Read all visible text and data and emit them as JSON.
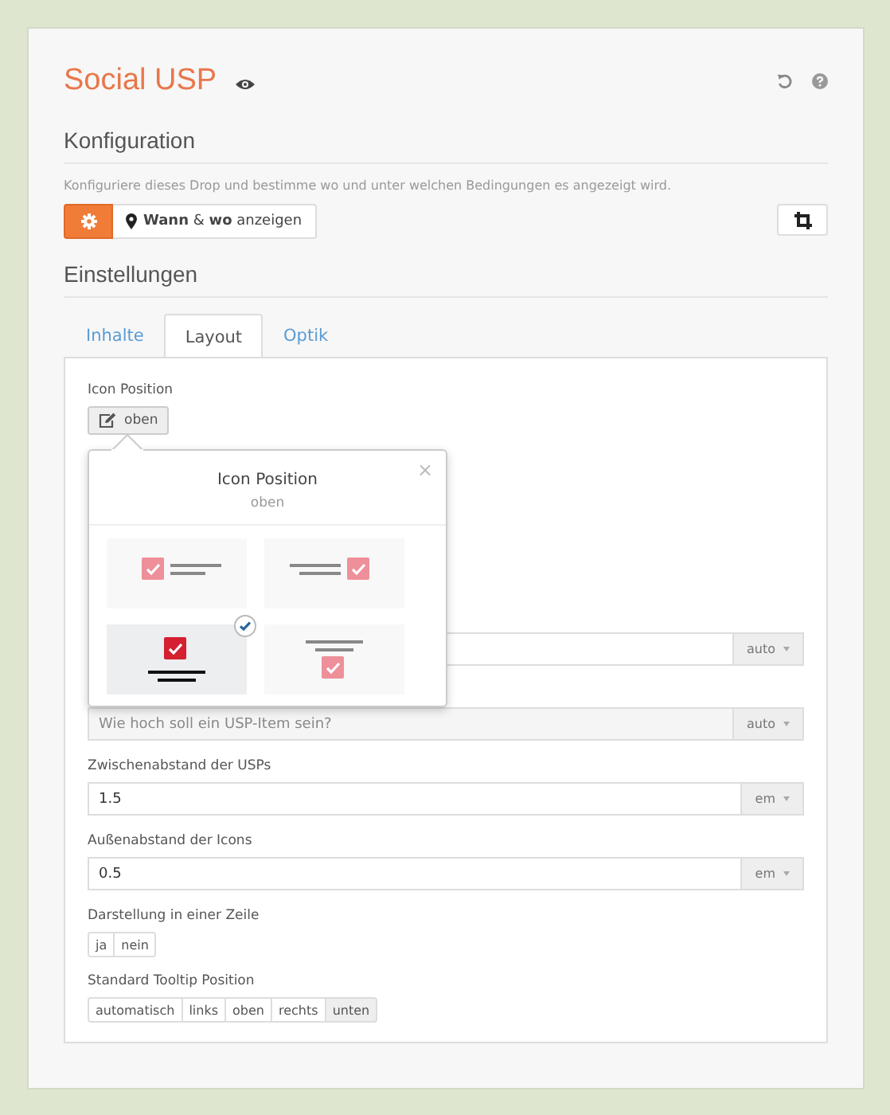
{
  "title": "Social USP",
  "config": {
    "heading": "Konfiguration",
    "description": "Konfiguriere dieses Drop und bestimme wo und unter welchen Bedingungen es angezeigt wird.",
    "where_button": "**Wann** & **wo** anzeigen"
  },
  "settings": {
    "heading": "Einstellungen"
  },
  "tabs": [
    {
      "label": "Inhalte",
      "selected": false
    },
    {
      "label": "Layout",
      "selected": true
    },
    {
      "label": "Optik",
      "selected": false
    }
  ],
  "icon_position": {
    "label": "Icon Position",
    "value": "oben"
  },
  "popover": {
    "title": "Icon Position",
    "subtitle": "oben",
    "close": "×",
    "options": [
      {
        "kind": "icon-left",
        "selected": false
      },
      {
        "kind": "icon-right",
        "selected": false
      },
      {
        "kind": "icon-top",
        "selected": true
      },
      {
        "kind": "icon-bottom",
        "selected": false
      }
    ]
  },
  "fields": [
    {
      "unit": "auto"
    },
    {
      "placeholder": "Wie hoch soll ein USP-Item sein?",
      "unit": "auto"
    },
    {
      "label": "Zwischenabstand der USPs",
      "value": "1.5",
      "unit": "em"
    },
    {
      "label": "Außenabstand der Icons",
      "value": "0.5",
      "unit": "em"
    }
  ],
  "toggles": [
    {
      "label": "Darstellung in einer Zeile",
      "options": [
        {
          "label": "ja",
          "selected": false
        },
        {
          "label": "nein",
          "selected": false
        }
      ]
    },
    {
      "label": "Standard Tooltip Position",
      "options": [
        {
          "label": "automatisch",
          "selected": false
        },
        {
          "label": "links",
          "selected": false
        },
        {
          "label": "oben",
          "selected": false
        },
        {
          "label": "rechts",
          "selected": false
        },
        {
          "label": "unten",
          "selected": true
        }
      ]
    }
  ]
}
